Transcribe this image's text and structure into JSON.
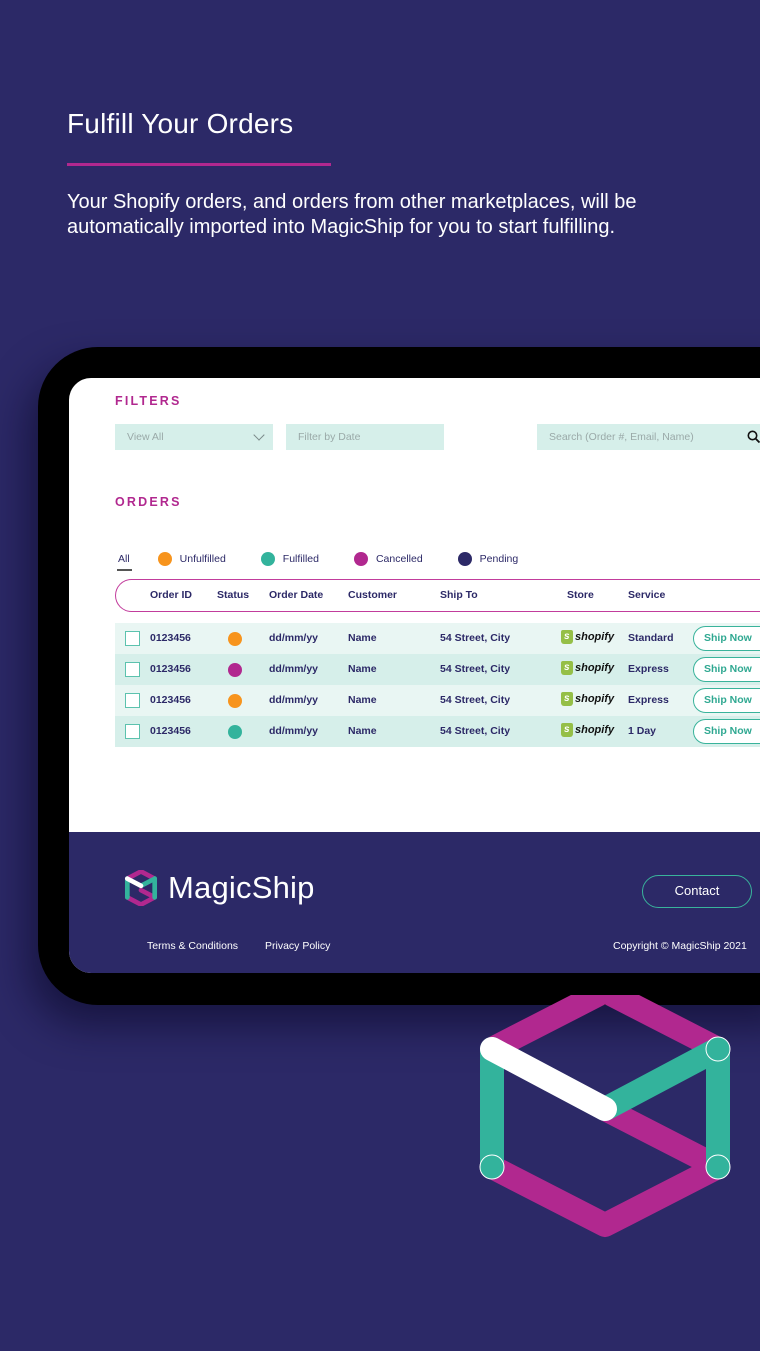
{
  "hero": {
    "title": "Fulfill Your Orders",
    "description": "Your Shopify orders, and orders from other marketplaces, will be automatically imported into MagicShip for you to start fulfilling."
  },
  "colors": {
    "background": "#2c2967",
    "accent_magenta": "#b1288f",
    "accent_teal": "#33b39c",
    "unfulfilled": "#f7941d",
    "fulfilled": "#33b39c",
    "cancelled": "#b1288f",
    "pending": "#2c2967"
  },
  "filters": {
    "label": "FILTERS",
    "view_select": {
      "value": "View All"
    },
    "date_filter": {
      "placeholder": "Filter by Date"
    },
    "search": {
      "placeholder": "Search (Order #, Email, Name)"
    }
  },
  "orders": {
    "label": "ORDERS",
    "tabs": [
      {
        "label": "All",
        "active": true
      },
      {
        "label": "Unfulfilled",
        "color": "#f7941d"
      },
      {
        "label": "Fulfilled",
        "color": "#33b39c"
      },
      {
        "label": "Cancelled",
        "color": "#b1288f"
      },
      {
        "label": "Pending",
        "color": "#2c2967"
      }
    ],
    "columns": [
      "Order ID",
      "Status",
      "Order Date",
      "Customer",
      "Ship To",
      "Store",
      "Service"
    ],
    "rows": [
      {
        "order_id": "0123456",
        "status": "Unfulfilled",
        "status_color": "#f7941d",
        "date": "dd/mm/yy",
        "customer": "Name",
        "ship_to": "54 Street, City",
        "store": "shopify",
        "service": "Standard",
        "action": "Ship Now"
      },
      {
        "order_id": "0123456",
        "status": "Cancelled",
        "status_color": "#b1288f",
        "date": "dd/mm/yy",
        "customer": "Name",
        "ship_to": "54 Street, City",
        "store": "shopify",
        "service": "Express",
        "action": "Ship Now"
      },
      {
        "order_id": "0123456",
        "status": "Unfulfilled",
        "status_color": "#f7941d",
        "date": "dd/mm/yy",
        "customer": "Name",
        "ship_to": "54 Street, City",
        "store": "shopify",
        "service": "Express",
        "action": "Ship Now"
      },
      {
        "order_id": "0123456",
        "status": "Fulfilled",
        "status_color": "#33b39c",
        "date": "dd/mm/yy",
        "customer": "Name",
        "ship_to": "54 Street, City",
        "store": "shopify",
        "service": "1 Day",
        "action": "Ship Now"
      }
    ]
  },
  "footer": {
    "brand": "MagicShip",
    "contact_label": "Contact",
    "links": [
      "Terms & Conditions",
      "Privacy Policy"
    ],
    "copyright": "Copyright © MagicShip 2021"
  }
}
